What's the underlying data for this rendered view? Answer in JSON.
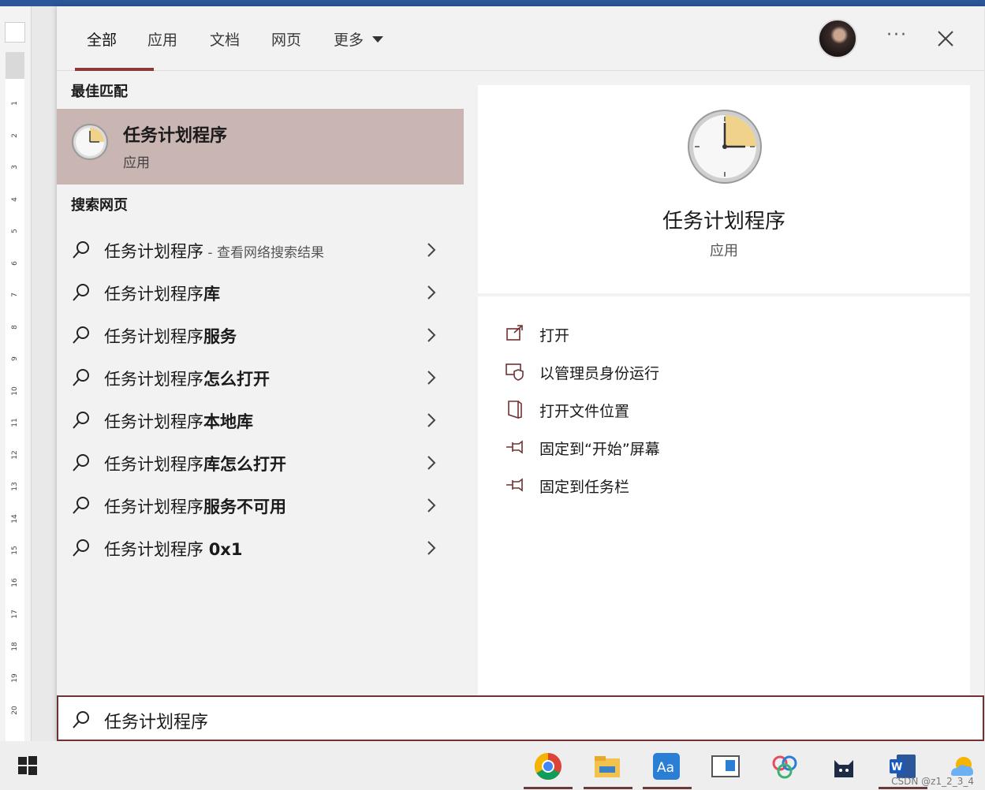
{
  "tabs": [
    {
      "label": "全部"
    },
    {
      "label": "应用"
    },
    {
      "label": "文档"
    },
    {
      "label": "网页"
    },
    {
      "label": "更多"
    }
  ],
  "header": {
    "more_dots": "···"
  },
  "best_match": {
    "section_title": "最佳匹配",
    "name": "任务计划程序",
    "type": "应用",
    "icon": "clock-icon"
  },
  "web": {
    "section_title": "搜索网页",
    "items": [
      {
        "base": "任务计划程序",
        "suffix": "",
        "sub": " - 查看网络搜索结果"
      },
      {
        "base": "任务计划程序",
        "suffix": "库",
        "sub": ""
      },
      {
        "base": "任务计划程序",
        "suffix": "服务",
        "sub": ""
      },
      {
        "base": "任务计划程序",
        "suffix": "怎么打开",
        "sub": ""
      },
      {
        "base": "任务计划程序",
        "suffix": "本地库",
        "sub": ""
      },
      {
        "base": "任务计划程序",
        "suffix": "库怎么打开",
        "sub": ""
      },
      {
        "base": "任务计划程序",
        "suffix": "服务不可用",
        "sub": ""
      },
      {
        "base": "任务计划程序 ",
        "suffix": "0x1",
        "sub": ""
      }
    ]
  },
  "detail": {
    "name": "任务计划程序",
    "type": "应用",
    "actions": [
      {
        "label": "打开",
        "icon": "open-icon"
      },
      {
        "label": "以管理员身份运行",
        "icon": "admin-shield-icon"
      },
      {
        "label": "打开文件位置",
        "icon": "file-location-icon"
      },
      {
        "label": "固定到“开始”屏幕",
        "icon": "pin-start-icon"
      },
      {
        "label": "固定到任务栏",
        "icon": "pin-taskbar-icon"
      }
    ]
  },
  "search": {
    "query": "任务计划程序"
  },
  "ruler": {
    "numbers": [
      "1",
      "2",
      "3",
      "4",
      "5",
      "6",
      "7",
      "8",
      "9",
      "10",
      "11",
      "12",
      "13",
      "14",
      "15",
      "16",
      "17",
      "18",
      "19",
      "20"
    ]
  },
  "taskbar": {
    "apps": [
      "chrome-icon",
      "file-explorer-icon",
      "dictionary-icon",
      "window-app-icon",
      "baidu-netdisk-icon",
      "cat-app-icon",
      "word-icon",
      "weather-icon"
    ],
    "watermark": "CSDN @z1_2_3_4"
  },
  "colors": {
    "accent": "#8b3a3a",
    "selected": "#c9b5b2",
    "border": "#6e3232"
  }
}
